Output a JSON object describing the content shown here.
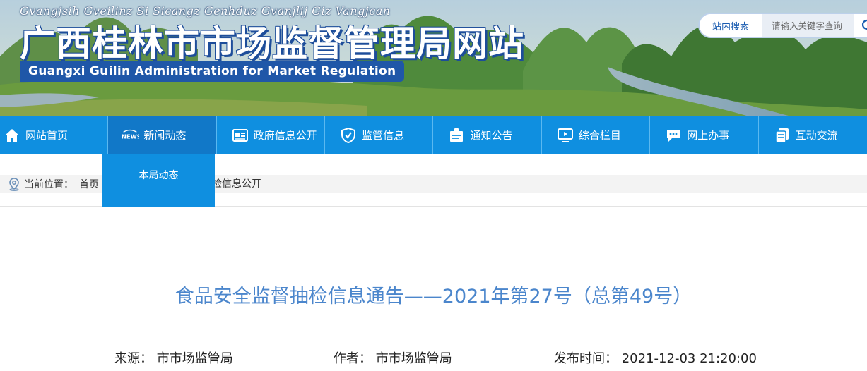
{
  "header": {
    "zhuang_title": "Gvangjsih Gveilinz Si Sicangz Genhduz Gvanjlij Giz Vangjcan",
    "cn_title": "广西桂林市市场监督管理局网站",
    "en_title": "Guangxi Guilin Administration for Market Regulation"
  },
  "search": {
    "tab_label": "站内搜索",
    "placeholder": "请输入关键字查询"
  },
  "nav": {
    "items": [
      {
        "label": "网站首页",
        "icon": "home-icon"
      },
      {
        "label": "新闻动态",
        "icon": "news-icon"
      },
      {
        "label": "政府信息公开",
        "icon": "gov-info-icon"
      },
      {
        "label": "监管信息",
        "icon": "shield-icon"
      },
      {
        "label": "通知公告",
        "icon": "notice-icon"
      },
      {
        "label": "综合栏目",
        "icon": "monitor-icon"
      },
      {
        "label": "网上办事",
        "icon": "chat-icon"
      },
      {
        "label": "互动交流",
        "icon": "copy-icon"
      }
    ],
    "dropdown": {
      "items": [
        "本局动态"
      ]
    }
  },
  "breadcrumb": {
    "prefix": "当前位置：",
    "home": "首页",
    "tail": "抽检信息公开"
  },
  "article": {
    "title": "食品安全监督抽检信息通告——2021年第27号（总第49号）",
    "source_label": "来源：",
    "source_value": "市市场监管局",
    "author_label": "作者：",
    "author_value": "市市场监管局",
    "date_label": "发布时间：",
    "date_value": "2021-12-03 21:20:00"
  },
  "colors": {
    "nav_bg": "#0f8fe0",
    "title_blue": "#4b86cc",
    "banner_badge": "#1f57a8"
  }
}
